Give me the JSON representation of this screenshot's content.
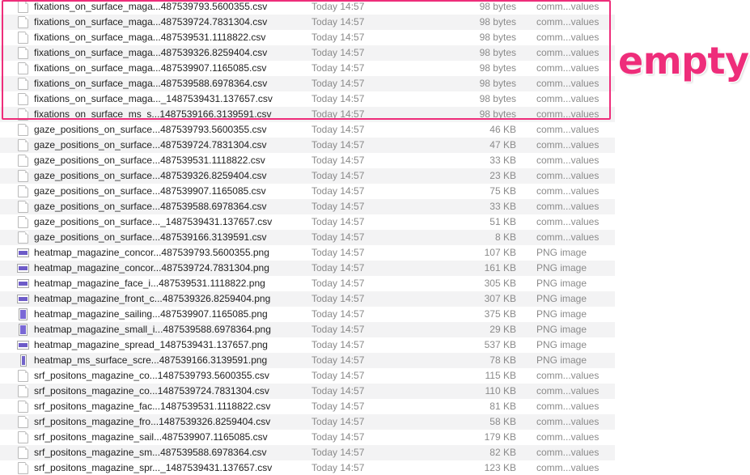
{
  "annotation": {
    "text": "empty",
    "color": "#ee2d7a"
  },
  "files": [
    {
      "name": "fixations_on_surface_maga...487539793.5600355.csv",
      "date": "Today 14:57",
      "size": "98 bytes",
      "kind": "comm...values",
      "icon": "document-icon"
    },
    {
      "name": "fixations_on_surface_maga...487539724.7831304.csv",
      "date": "Today 14:57",
      "size": "98 bytes",
      "kind": "comm...values",
      "icon": "document-icon"
    },
    {
      "name": "fixations_on_surface_maga...487539531.1118822.csv",
      "date": "Today 14:57",
      "size": "98 bytes",
      "kind": "comm...values",
      "icon": "document-icon"
    },
    {
      "name": "fixations_on_surface_maga...487539326.8259404.csv",
      "date": "Today 14:57",
      "size": "98 bytes",
      "kind": "comm...values",
      "icon": "document-icon"
    },
    {
      "name": "fixations_on_surface_maga...487539907.1165085.csv",
      "date": "Today 14:57",
      "size": "98 bytes",
      "kind": "comm...values",
      "icon": "document-icon"
    },
    {
      "name": "fixations_on_surface_maga...487539588.6978364.csv",
      "date": "Today 14:57",
      "size": "98 bytes",
      "kind": "comm...values",
      "icon": "document-icon"
    },
    {
      "name": "fixations_on_surface_maga..._1487539431.137657.csv",
      "date": "Today 14:57",
      "size": "98 bytes",
      "kind": "comm...values",
      "icon": "document-icon"
    },
    {
      "name": "fixations_on_surface_ms_s...1487539166.3139591.csv",
      "date": "Today 14:57",
      "size": "98 bytes",
      "kind": "comm...values",
      "icon": "document-icon"
    },
    {
      "name": "gaze_positions_on_surface...487539793.5600355.csv",
      "date": "Today 14:57",
      "size": "46 KB",
      "kind": "comm...values",
      "icon": "document-icon"
    },
    {
      "name": "gaze_positions_on_surface...487539724.7831304.csv",
      "date": "Today 14:57",
      "size": "47 KB",
      "kind": "comm...values",
      "icon": "document-icon"
    },
    {
      "name": "gaze_positions_on_surface...487539531.1118822.csv",
      "date": "Today 14:57",
      "size": "33 KB",
      "kind": "comm...values",
      "icon": "document-icon"
    },
    {
      "name": "gaze_positions_on_surface...487539326.8259404.csv",
      "date": "Today 14:57",
      "size": "23 KB",
      "kind": "comm...values",
      "icon": "document-icon"
    },
    {
      "name": "gaze_positions_on_surface...487539907.1165085.csv",
      "date": "Today 14:57",
      "size": "75 KB",
      "kind": "comm...values",
      "icon": "document-icon"
    },
    {
      "name": "gaze_positions_on_surface...487539588.6978364.csv",
      "date": "Today 14:57",
      "size": "33 KB",
      "kind": "comm...values",
      "icon": "document-icon"
    },
    {
      "name": "gaze_positions_on_surface..._1487539431.137657.csv",
      "date": "Today 14:57",
      "size": "51 KB",
      "kind": "comm...values",
      "icon": "document-icon"
    },
    {
      "name": "gaze_positions_on_surface...487539166.3139591.csv",
      "date": "Today 14:57",
      "size": "8 KB",
      "kind": "comm...values",
      "icon": "document-icon"
    },
    {
      "name": "heatmap_magazine_concor...487539793.5600355.png",
      "date": "Today 14:57",
      "size": "107 KB",
      "kind": "PNG image",
      "icon": "image-wide-icon"
    },
    {
      "name": "heatmap_magazine_concor...487539724.7831304.png",
      "date": "Today 14:57",
      "size": "161 KB",
      "kind": "PNG image",
      "icon": "image-wide-icon"
    },
    {
      "name": "heatmap_magazine_face_i...487539531.1118822.png",
      "date": "Today 14:57",
      "size": "305 KB",
      "kind": "PNG image",
      "icon": "image-wide-icon"
    },
    {
      "name": "heatmap_magazine_front_c...487539326.8259404.png",
      "date": "Today 14:57",
      "size": "307 KB",
      "kind": "PNG image",
      "icon": "image-wide-icon"
    },
    {
      "name": "heatmap_magazine_sailing...487539907.1165085.png",
      "date": "Today 14:57",
      "size": "375 KB",
      "kind": "PNG image",
      "icon": "image-tall-icon"
    },
    {
      "name": "heatmap_magazine_small_i...487539588.6978364.png",
      "date": "Today 14:57",
      "size": "29 KB",
      "kind": "PNG image",
      "icon": "image-tall-icon"
    },
    {
      "name": "heatmap_magazine_spread_1487539431.137657.png",
      "date": "Today 14:57",
      "size": "537 KB",
      "kind": "PNG image",
      "icon": "image-wide-icon"
    },
    {
      "name": "heatmap_ms_surface_scre...487539166.3139591.png",
      "date": "Today 14:57",
      "size": "78 KB",
      "kind": "PNG image",
      "icon": "image-narrow-icon"
    },
    {
      "name": "srf_positons_magazine_co...1487539793.5600355.csv",
      "date": "Today 14:57",
      "size": "115 KB",
      "kind": "comm...values",
      "icon": "document-icon"
    },
    {
      "name": "srf_positons_magazine_co...1487539724.7831304.csv",
      "date": "Today 14:57",
      "size": "110 KB",
      "kind": "comm...values",
      "icon": "document-icon"
    },
    {
      "name": "srf_positons_magazine_fac...1487539531.1118822.csv",
      "date": "Today 14:57",
      "size": "81 KB",
      "kind": "comm...values",
      "icon": "document-icon"
    },
    {
      "name": "srf_positons_magazine_fro...1487539326.8259404.csv",
      "date": "Today 14:57",
      "size": "58 KB",
      "kind": "comm...values",
      "icon": "document-icon"
    },
    {
      "name": "srf_positons_magazine_sail...487539907.1165085.csv",
      "date": "Today 14:57",
      "size": "179 KB",
      "kind": "comm...values",
      "icon": "document-icon"
    },
    {
      "name": "srf_positons_magazine_sm...487539588.6978364.csv",
      "date": "Today 14:57",
      "size": "82 KB",
      "kind": "comm...values",
      "icon": "document-icon"
    },
    {
      "name": "srf_positons_magazine_spr..._1487539431.137657.csv",
      "date": "Today 14:57",
      "size": "123 KB",
      "kind": "comm...values",
      "icon": "document-icon"
    }
  ]
}
